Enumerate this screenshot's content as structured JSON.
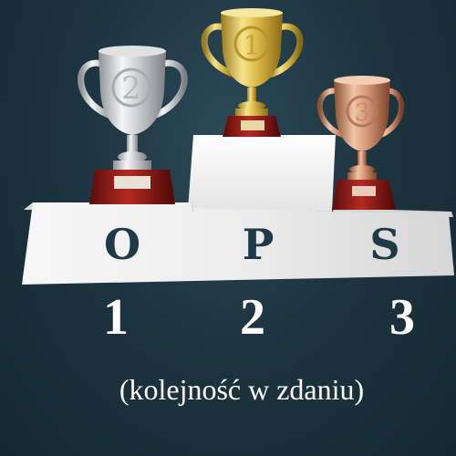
{
  "podium": {
    "letters": [
      "O",
      "P",
      "S"
    ],
    "ranks": [
      "1",
      "2",
      "3"
    ],
    "caption": "(kolejność w zdaniu)"
  },
  "trophies": [
    {
      "place": "2",
      "material": "silver"
    },
    {
      "place": "1",
      "material": "gold"
    },
    {
      "place": "3",
      "material": "bronze"
    }
  ],
  "colors": {
    "background": "#1d3540",
    "podium": "#f2f2f2",
    "letter": "#1e3947",
    "rank_text": "#ffffff"
  }
}
